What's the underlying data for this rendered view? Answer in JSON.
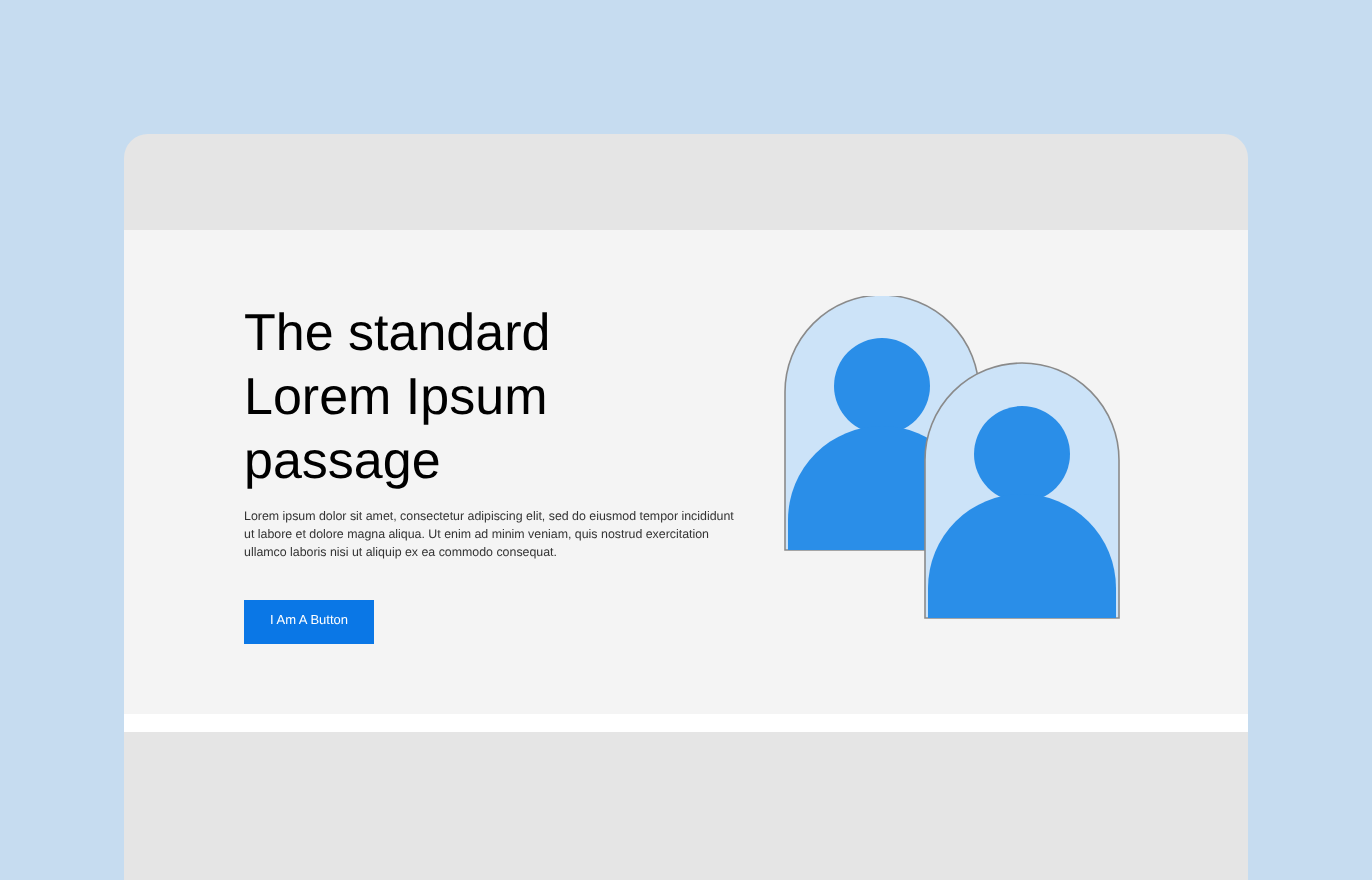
{
  "hero": {
    "title": "The standard Lorem Ipsum passage",
    "body": "Lorem ipsum dolor sit amet, consectetur adipiscing elit, sed do eiusmod tempor incididunt ut labore et dolore magna aliqua. Ut enim ad minim veniam, quis nostrud exercitation ullamco laboris nisi ut aliquip ex ea commodo consequat.",
    "button": "I Am A Button"
  }
}
